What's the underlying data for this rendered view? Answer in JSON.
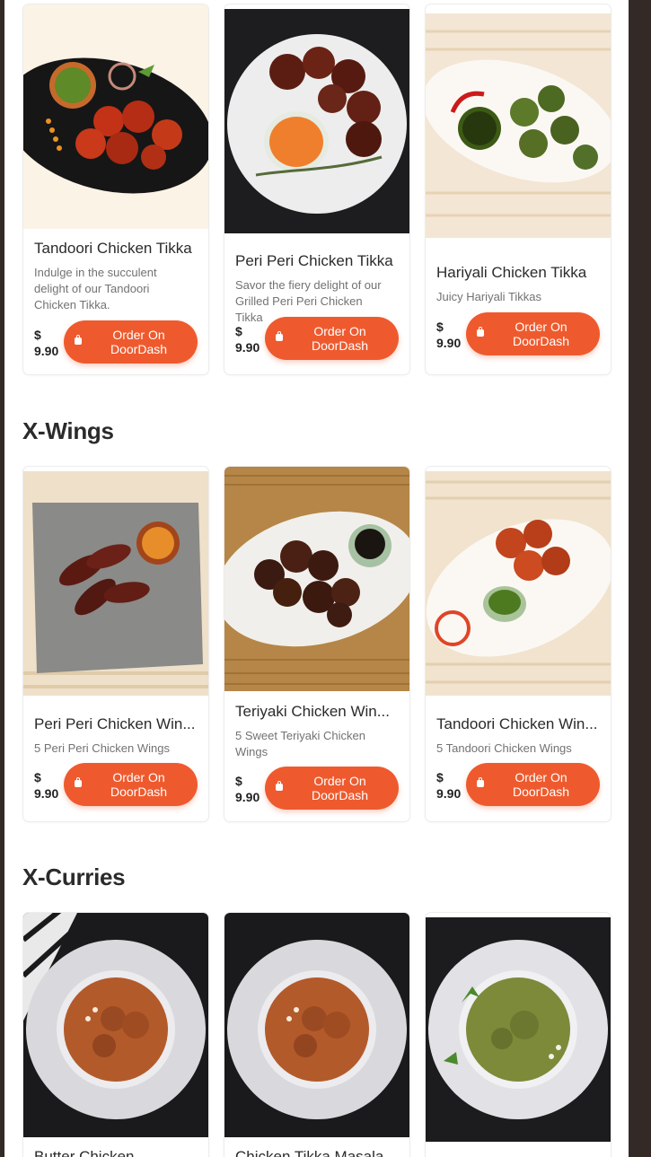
{
  "sections": [
    {
      "title": "",
      "items": [
        {
          "name": "Tandoori Chicken Tikka",
          "desc": "Indulge in the succulent delight of our Tandoori Chicken Tikka.",
          "price": "$ 9.90",
          "button": "Order On DoorDash"
        },
        {
          "name": "Peri Peri Chicken Tikka",
          "desc": "Savor the fiery delight of our Grilled Peri Peri Chicken Tikka",
          "price": "$ 9.90",
          "button": "Order On DoorDash"
        },
        {
          "name": "Hariyali Chicken Tikka",
          "desc": "Juicy Hariyali Tikkas",
          "price": "$ 9.90",
          "button": "Order On DoorDash"
        }
      ]
    },
    {
      "title": "X-Wings",
      "items": [
        {
          "name": "Peri Peri Chicken Win...",
          "desc": "5 Peri Peri Chicken Wings",
          "price": "$ 9.90",
          "button": "Order On DoorDash"
        },
        {
          "name": "Teriyaki Chicken Win...",
          "desc": "5 Sweet Teriyaki Chicken Wings",
          "price": "$ 9.90",
          "button": "Order On DoorDash"
        },
        {
          "name": "Tandoori Chicken Win...",
          "desc": "5 Tandoori Chicken Wings",
          "price": "$ 9.90",
          "button": "Order On DoorDash"
        }
      ]
    },
    {
      "title": "X-Curries",
      "items": [
        {
          "name": "Butter Chicken"
        },
        {
          "name": "Chicken Tikka Masala"
        },
        {
          "name": ""
        }
      ]
    }
  ],
  "photo_icons": [
    "tandoori-tikka-photo",
    "peri-peri-tikka-photo",
    "hariyali-tikka-photo",
    "peri-peri-wings-photo",
    "teriyaki-wings-photo",
    "tandoori-wings-photo",
    "butter-chicken-photo",
    "tikka-masala-photo",
    "green-curry-photo"
  ],
  "colors": {
    "accent": "#ee5a2e",
    "frame": "#332a27",
    "text": "#2b2b2b",
    "muted": "#727272"
  }
}
